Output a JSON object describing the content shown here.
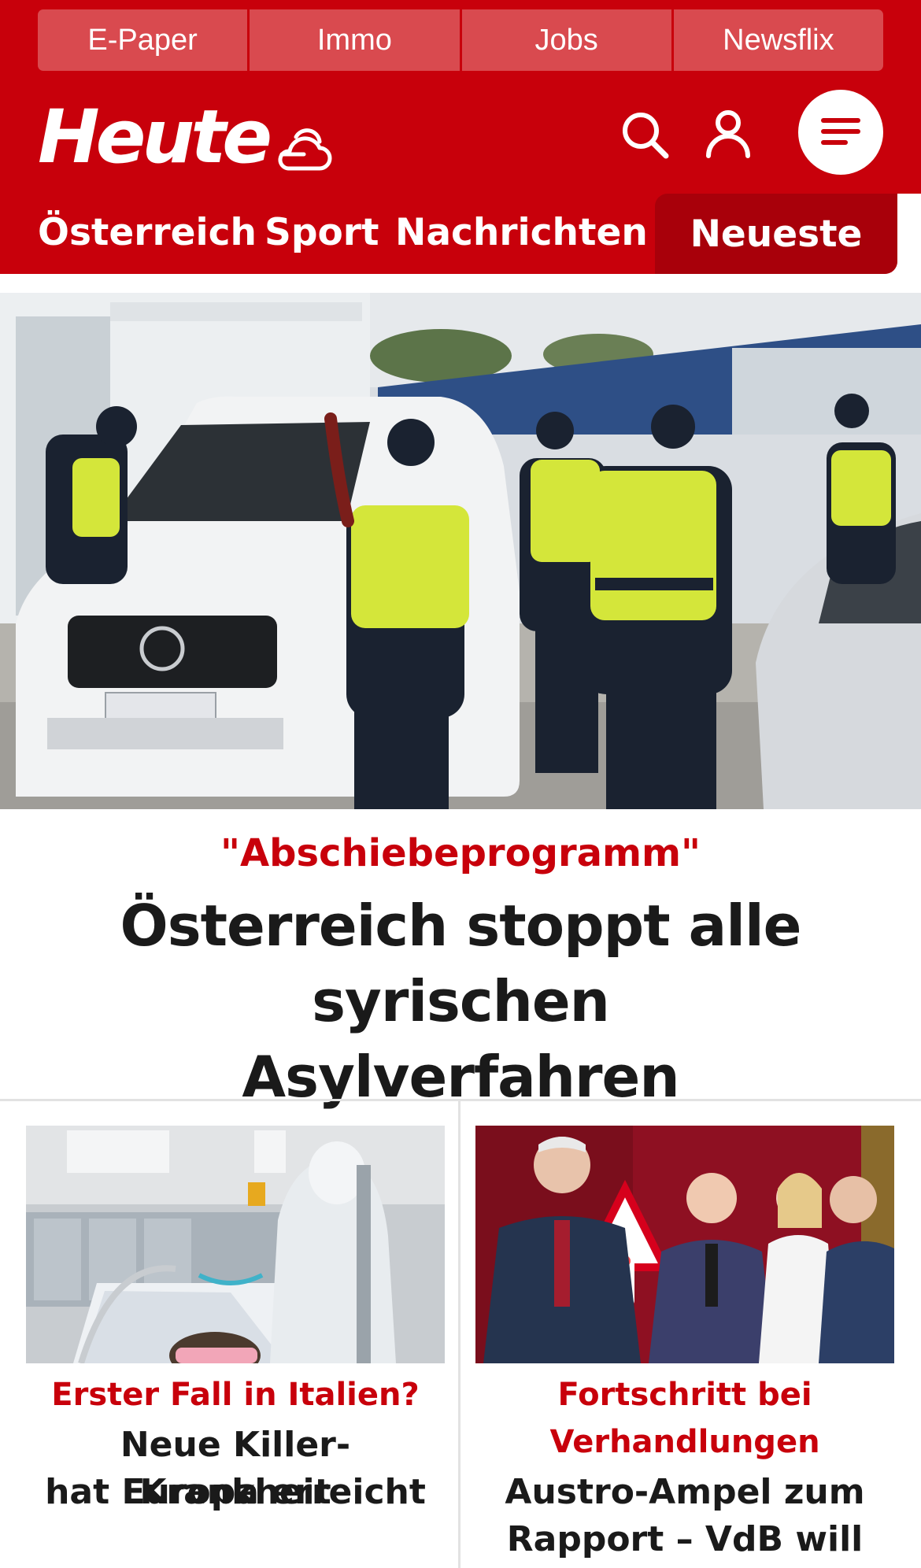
{
  "topnav": {
    "items": [
      "E-Paper",
      "Immo",
      "Jobs",
      "Newsflix"
    ]
  },
  "brand": {
    "logo_text": "Heute",
    "weather_icon": "cloud-sun-icon",
    "search_icon": "search-icon",
    "account_icon": "user-icon",
    "menu_icon": "menu-icon"
  },
  "sections": {
    "items": [
      "Österreich",
      "Sport",
      "Nachrichten"
    ],
    "active": "Neueste"
  },
  "hero": {
    "image_alt": "Polizeikontrolle an der Grenze",
    "kicker": "\"Abschiebeprogramm\"",
    "title_line1": "Österreich stoppt alle syrischen",
    "title_line2": "Asylverfahren"
  },
  "teasers": [
    {
      "kicker_line1": "Erster Fall in Italien?",
      "kicker_line2": "",
      "title_line1": "Neue Killer-Krankheit",
      "title_line2": "hat Europa erreicht"
    },
    {
      "kicker_line1": "Fortschritt bei",
      "kicker_line2": "Verhandlungen",
      "title_line1": "Austro-Ampel zum",
      "title_line2": "Rapport – VdB will"
    }
  ],
  "colors": {
    "brand_red": "#c8000b",
    "nav_tab": "#d94a4f",
    "active_section": "#a8000a",
    "text": "#1a1a1a"
  }
}
